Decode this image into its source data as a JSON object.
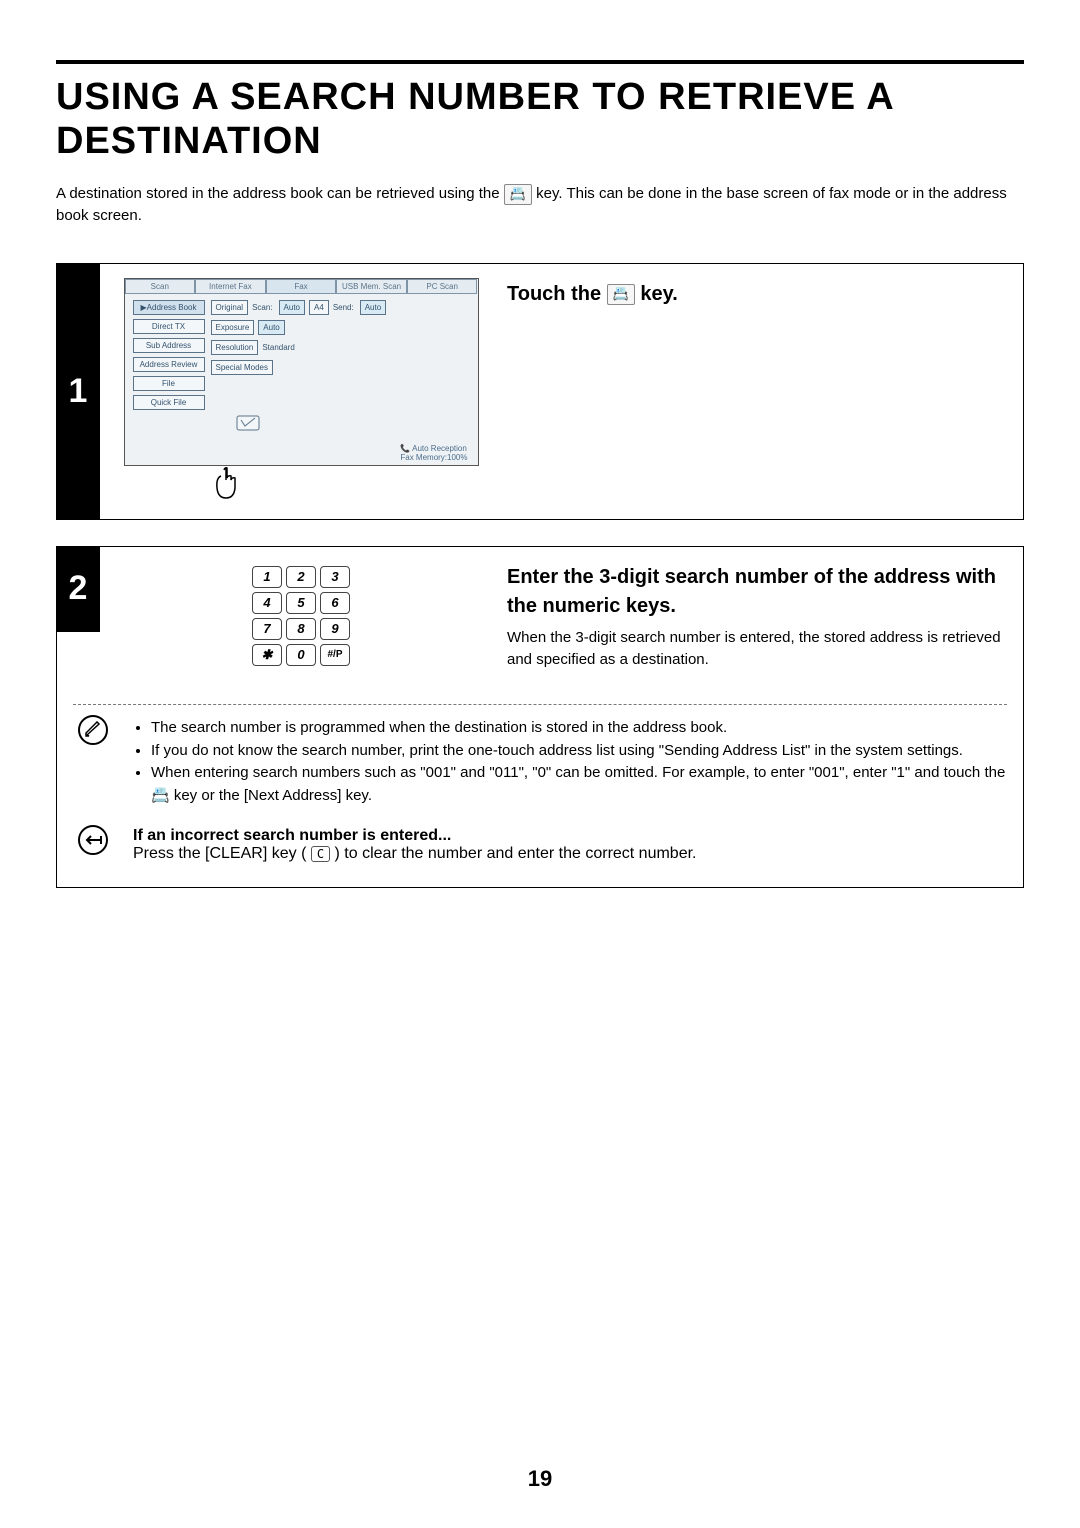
{
  "page": {
    "title": "USING A SEARCH NUMBER TO RETRIEVE A DESTINATION",
    "intro_before_icon": "A destination stored in the address book can be retrieved using the ",
    "intro_key_char": "📇",
    "intro_after_icon": " key. This can be done in the base screen of fax mode or in the address book screen.",
    "page_number": "19"
  },
  "step1": {
    "number": "1",
    "heading_before": "Touch the ",
    "heading_key_char": "📇",
    "heading_after": " key.",
    "screen": {
      "tabs": [
        "Scan",
        "Internet Fax",
        "Fax",
        "USB Mem. Scan",
        "PC Scan"
      ],
      "sidebar": [
        "Address Book",
        "Direct TX",
        "Sub Address",
        "Address Review",
        "File",
        "Quick File"
      ],
      "rows": {
        "original": {
          "label": "Original",
          "scan_lbl": "Scan:",
          "scan_val": "Auto",
          "page": "A4",
          "send_lbl": "Send:",
          "send_val": "Auto"
        },
        "exposure": {
          "label": "Exposure",
          "val": "Auto"
        },
        "resolution": {
          "label": "Resolution",
          "val": "Standard"
        },
        "special": {
          "label": "Special Modes"
        }
      },
      "bottom": {
        "reception": "Auto Reception",
        "memory": "Fax Memory:100%"
      }
    }
  },
  "step2": {
    "number": "2",
    "heading": "Enter the 3-digit search number of the address with the numeric keys.",
    "subtext": "When the 3-digit search number is entered, the stored address is retrieved and specified as a destination.",
    "keypad": [
      "1",
      "2",
      "3",
      "4",
      "5",
      "6",
      "7",
      "8",
      "9",
      "✱",
      "0",
      "#/P"
    ],
    "notes": [
      "The search number is programmed when the destination is stored in the address book.",
      "If you do not know the search number, print the one-touch address list using \"Sending Address List\" in the system settings.",
      "When entering search numbers such as \"001\" and \"011\", \"0\" can be omitted. For example, to enter \"001\", enter \"1\" and touch the 📇 key or the [Next Address] key."
    ],
    "cancel": {
      "title": "If an incorrect search number is entered...",
      "text_before": "Press the [CLEAR] key ( ",
      "clear_char": "C",
      "text_after": " ) to clear the number and enter the correct number."
    }
  }
}
